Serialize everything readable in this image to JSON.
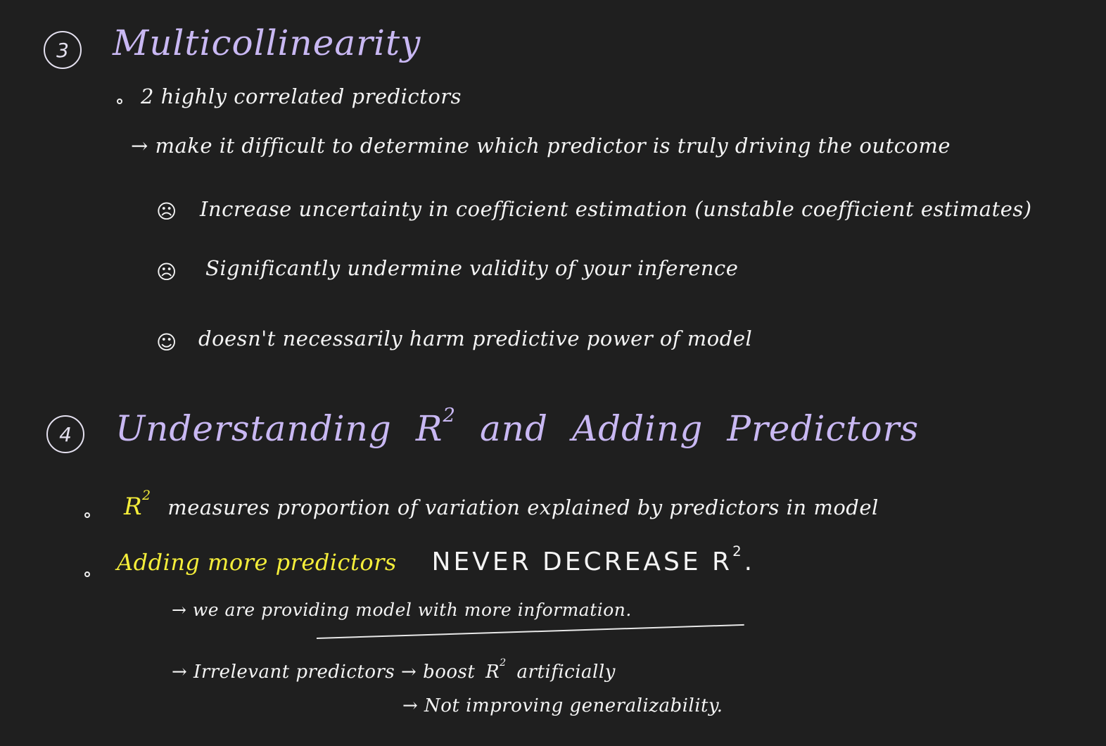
{
  "section3": {
    "number": "3",
    "title": "Multicollinearity",
    "bullet": "2 highly correlated predictors",
    "arrow_line": "→ make it difficult to determine which predictor is truly driving the outcome",
    "consequences": [
      {
        "icon": "sad-face-icon",
        "glyph": "☹",
        "text": "Increase uncertainty in coefficient estimation (unstable coefficient estimates)"
      },
      {
        "icon": "sad-face-icon",
        "glyph": "☹",
        "text": "Significantly undermine validity of your inference"
      },
      {
        "icon": "smile-face-icon",
        "glyph": "☺",
        "text": "doesn't necessarily harm predictive power of model"
      }
    ]
  },
  "section4": {
    "number": "4",
    "title_part1": "Understanding",
    "title_r": "R",
    "title_sup": "2",
    "title_part2": "and",
    "title_part3": "Adding",
    "title_part4": "Predictors",
    "bullet1": {
      "r": "R",
      "sup": "2",
      "text": "measures proportion of variation explained by predictors in model"
    },
    "bullet2": {
      "yellow_text": "Adding more predictors",
      "caps_text": "NEVER DECREASE R",
      "sup": "2",
      "end": "."
    },
    "sub1": "→ we are providing model with more information.",
    "sub2_part1": "→ Irrelevant predictors → boost",
    "sub2_r": "R",
    "sub2_sup": "2",
    "sub2_part2": "artificially",
    "sub3": "→ Not improving generalizability."
  },
  "colors": {
    "background": "#1f1f1f",
    "heading": "#c9b8f3",
    "ink": "#f4f4f4",
    "highlight": "#f5ee3a"
  }
}
